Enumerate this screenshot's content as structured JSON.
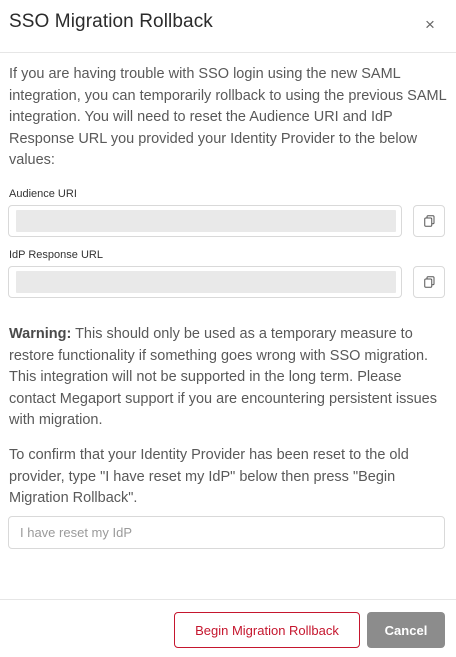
{
  "dialog": {
    "title": "SSO Migration Rollback",
    "close_icon": "close-icon",
    "intro": "If you are having trouble with SSO login using the new SAML integration, you can temporarily rollback to using the previous SAML integration. You will need to reset the Audience URI and IdP Response URL you provided your Identity Provider to the below values:"
  },
  "fields": {
    "audience_uri": {
      "label": "Audience URI",
      "icon": "copy-icon"
    },
    "idp_response_url": {
      "label": "IdP Response URL",
      "icon": "copy-icon"
    }
  },
  "warning": {
    "label": "Warning:",
    "text": " This should only be used as a temporary measure to restore functionality if something goes wrong with SSO migration. This integration will not be supported in the long term. Please contact Megaport support if you are encountering persistent issues with migration."
  },
  "confirm": {
    "instructions": "To confirm that your Identity Provider has been reset to the old provider, type \"I have reset my IdP\" below then press \"Begin Migration Rollback\".",
    "value": "",
    "placeholder": "I have reset my IdP"
  },
  "footer": {
    "rollback_label": "Begin Migration Rollback",
    "cancel_label": "Cancel"
  },
  "colors": {
    "accent_red": "#c5162e",
    "cancel_gray": "#8c8c8c",
    "masked_field": "#e9e9e9"
  }
}
